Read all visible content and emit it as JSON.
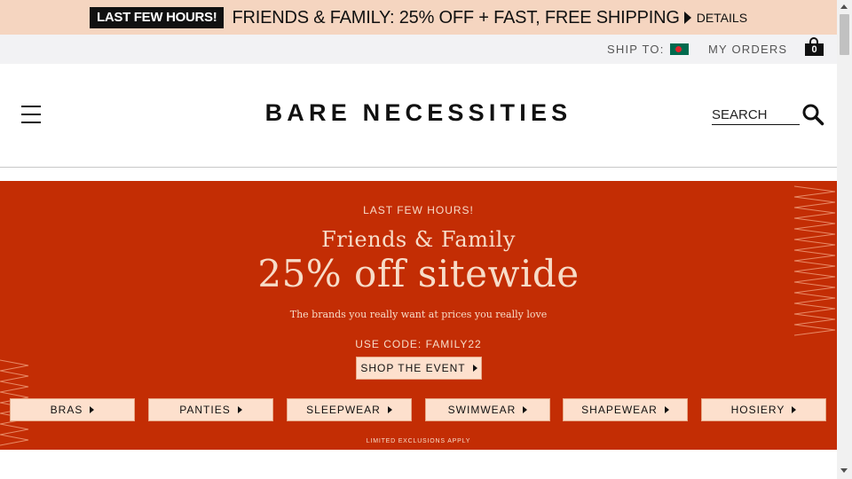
{
  "promo_bar": {
    "badge": "LAST FEW HOURS!",
    "text": "FRIENDS & FAMILY: 25% OFF + FAST, FREE SHIPPING",
    "details_link": "DETAILS",
    "background": "#f5d5c0"
  },
  "utility_bar": {
    "ship_to_label": "SHIP TO:",
    "ship_to_flag": "bangladesh-flag-icon",
    "my_orders": "MY ORDERS",
    "cart_count": "0"
  },
  "header": {
    "brand": "BARE NECESSITIES",
    "search_placeholder": "SEARCH",
    "menu_icon": "hamburger-menu-icon",
    "search_icon": "search-icon"
  },
  "hero": {
    "background": "#c32d04",
    "kicker": "LAST FEW HOURS!",
    "title": "Friends & Family",
    "headline": "25% off sitewide",
    "subtitle": "The brands you really want at prices you really love",
    "code_text": "USE CODE: FAMILY22",
    "cta_label": "SHOP THE EVENT",
    "categories": [
      {
        "label": "BRAS"
      },
      {
        "label": "PANTIES"
      },
      {
        "label": "SLEEPWEAR"
      },
      {
        "label": "SWIMWEAR"
      },
      {
        "label": "SHAPEWEAR"
      },
      {
        "label": "HOSIERY"
      }
    ],
    "disclaimer": "LIMITED EXCLUSIONS APPLY"
  }
}
